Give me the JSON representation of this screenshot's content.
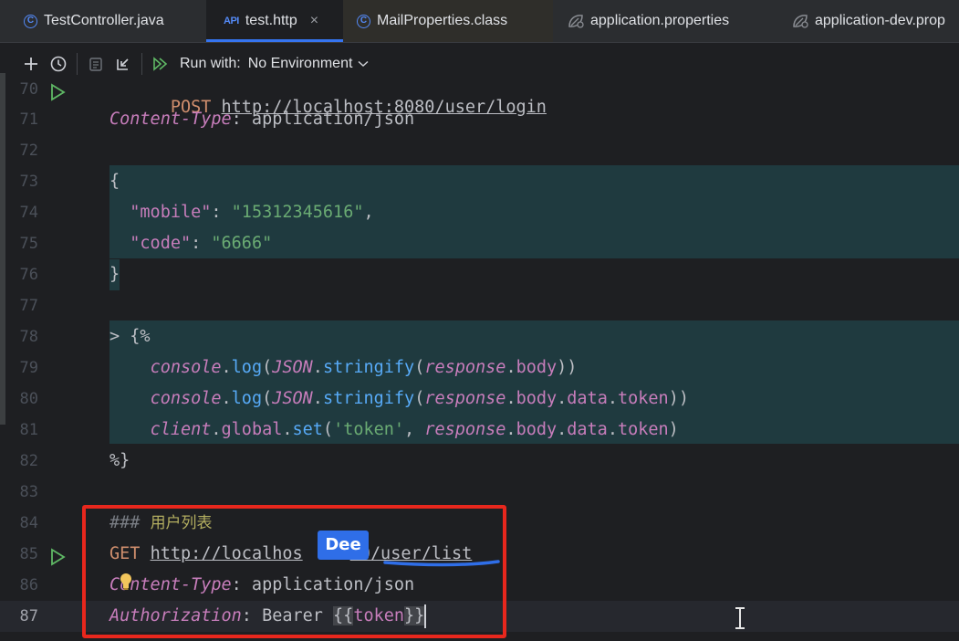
{
  "tabs": [
    {
      "label": "TestController.java",
      "icon": "class-c-icon"
    },
    {
      "label": "test.http",
      "icon": "api-icon",
      "icon_text": "API",
      "active": true
    },
    {
      "label": "MailProperties.class",
      "icon": "class-c-icon"
    },
    {
      "label": "application.properties",
      "icon": "spring-leaf-icon"
    },
    {
      "label": "application-dev.prop",
      "icon": "spring-leaf-icon"
    }
  ],
  "toolbar": {
    "run_with_label": "Run with:",
    "environment": "No Environment"
  },
  "editor": {
    "lines": [
      {
        "n": "70",
        "text": "POST http://localhost:8080/user/login"
      },
      {
        "n": "71",
        "text": "Content-Type: application/json"
      },
      {
        "n": "72",
        "text": ""
      },
      {
        "n": "73",
        "text": "{"
      },
      {
        "n": "74",
        "text": "  \"mobile\": \"15312345616\","
      },
      {
        "n": "75",
        "text": "  \"code\": \"6666\""
      },
      {
        "n": "76",
        "text": "}"
      },
      {
        "n": "77",
        "text": ""
      },
      {
        "n": "78",
        "text": "> {%"
      },
      {
        "n": "79",
        "text": "    console.log(JSON.stringify(response.body))"
      },
      {
        "n": "80",
        "text": "    console.log(JSON.stringify(response.body.data.token))"
      },
      {
        "n": "81",
        "text": "    client.global.set('token', response.body.data.token)"
      },
      {
        "n": "82",
        "text": "%}"
      },
      {
        "n": "83",
        "text": ""
      },
      {
        "n": "84",
        "text": "### 用户列表"
      },
      {
        "n": "85",
        "text": "GET http://localhost:8080/user/list"
      },
      {
        "n": "86",
        "text": "Content-Type: application/json"
      },
      {
        "n": "87",
        "text": "Authorization: Bearer {{token}}"
      }
    ],
    "tokens": {
      "post": "POST",
      "login_url": "http://localhost:8080/user/login",
      "content_type": "Content-Type",
      "colon": ":",
      "app_json": " application/json",
      "lbrace": "{",
      "rbrace": "}",
      "mobile_key": "\"mobile\"",
      "mobile_val": "\"15312345616\"",
      "code_key": "\"code\"",
      "code_val": "\"6666\"",
      "comma": ",",
      "script_open": "> {%",
      "script_close": "%}",
      "console": "console",
      "dot": ".",
      "log": "log",
      "lparen": "(",
      "rparen": ")",
      "json_obj": "JSON",
      "stringify": "stringify",
      "response": "response",
      "body": "body",
      "data": "data",
      "token": "token",
      "client": "client",
      "global": "global",
      "set": "set",
      "token_str": "'token'",
      "comma_sp": ", ",
      "hash": "### ",
      "section_title": "用户列表",
      "get": "GET",
      "list_url_a": "http://localhos",
      "list_url_b": "80/user/list",
      "authorization": "Authorization",
      "bearer": " Bearer ",
      "tpl_open": "{{",
      "tpl_close": "}}"
    },
    "popup_text": "Dee"
  }
}
